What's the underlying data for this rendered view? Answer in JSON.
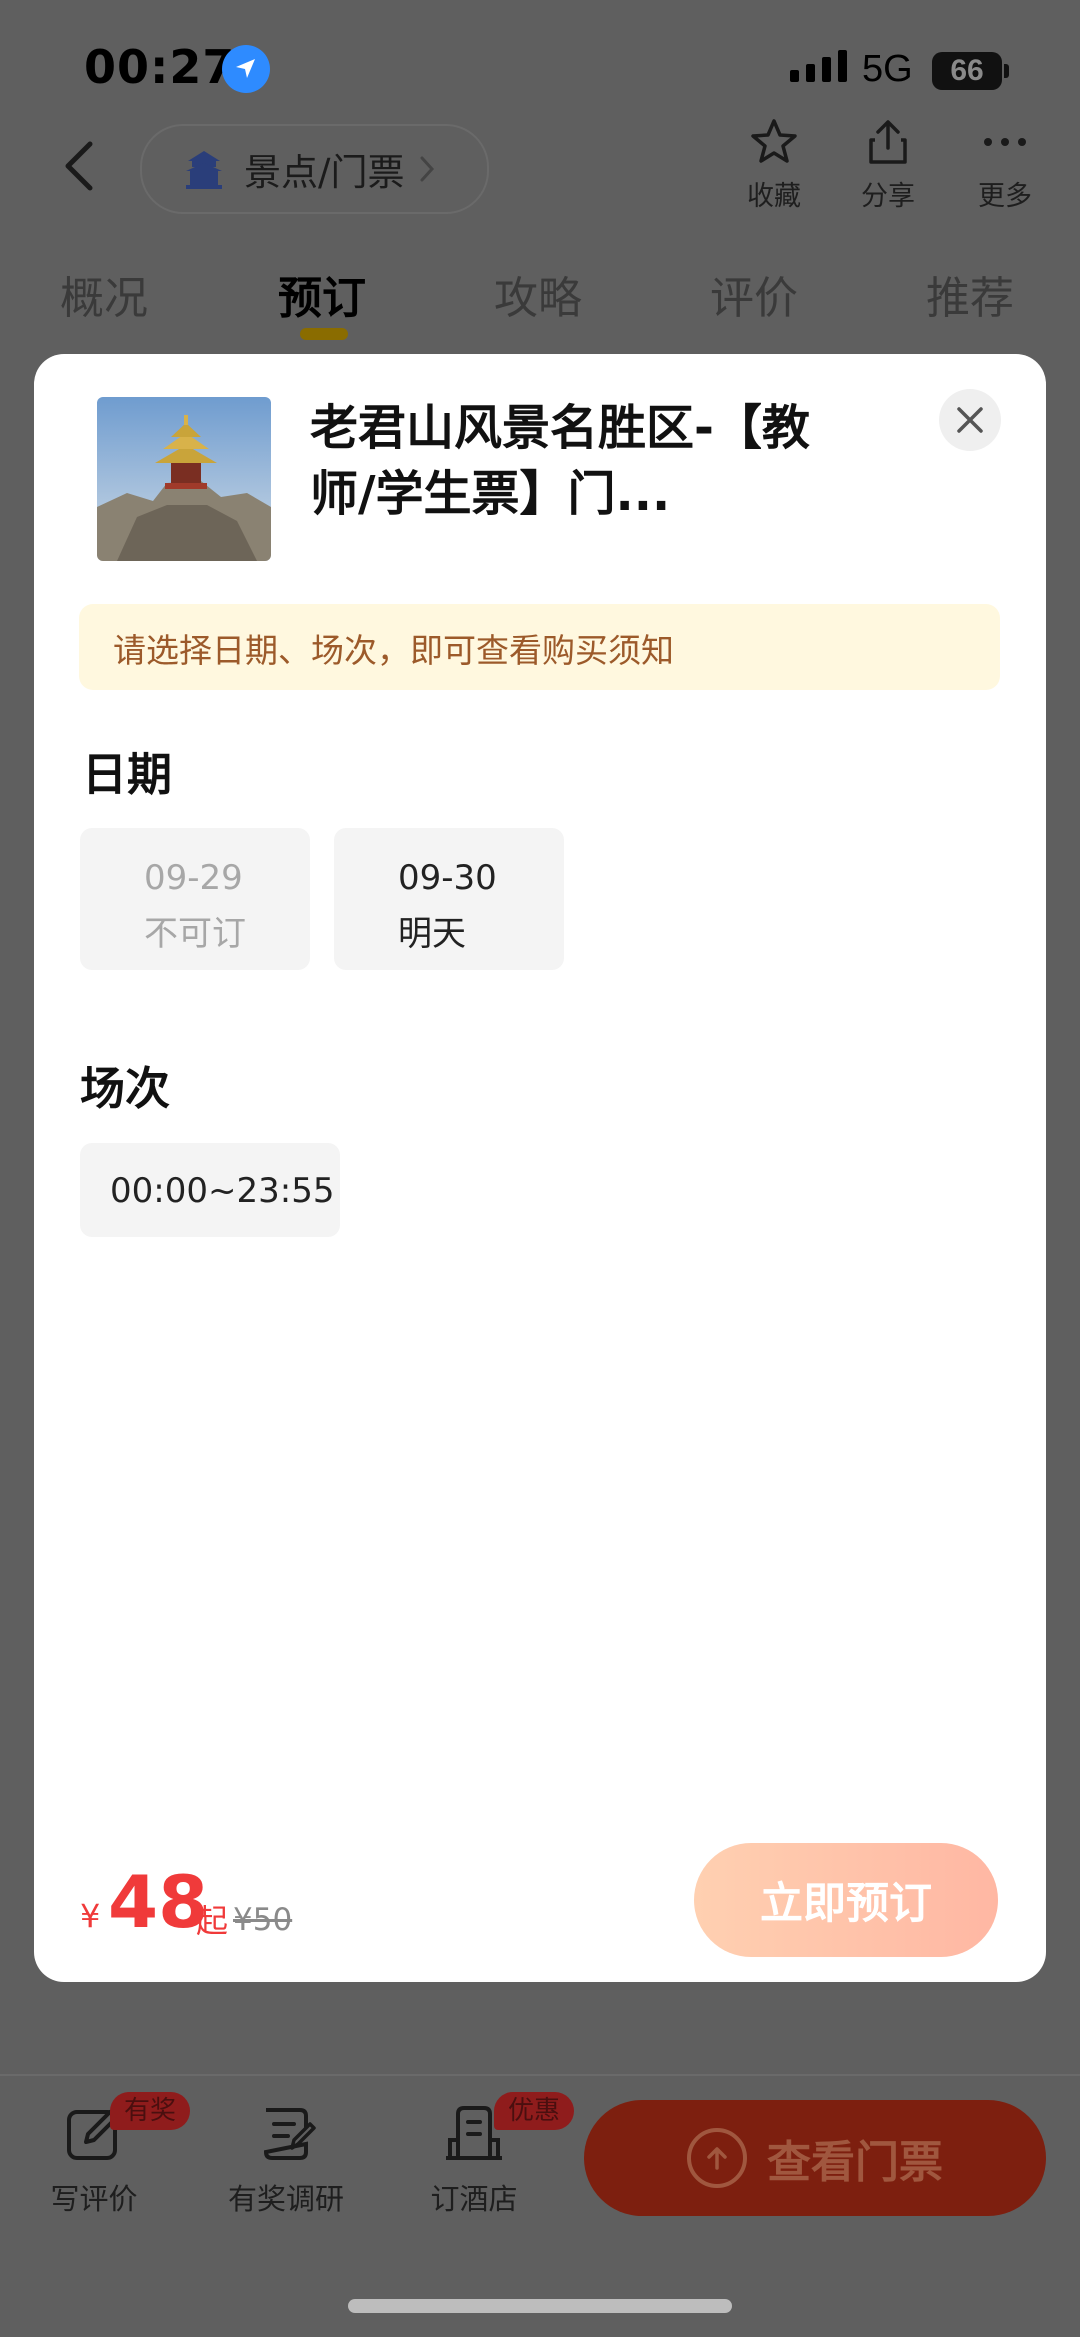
{
  "status": {
    "time": "00:27",
    "network": "5G",
    "battery": "66"
  },
  "header": {
    "breadcrumb": "景点/门票",
    "actions": [
      {
        "label": "收藏",
        "icon": "star-icon"
      },
      {
        "label": "分享",
        "icon": "share-icon"
      },
      {
        "label": "更多",
        "icon": "more-icon"
      }
    ]
  },
  "tabs": [
    "概况",
    "预订",
    "攻略",
    "评价",
    "推荐"
  ],
  "active_tab": "预订",
  "sheet": {
    "title": "老君山风景名胜区-【教师/学生票】门...",
    "notice": "请选择日期、场次，即可查看购买须知",
    "date_title": "日期",
    "dates": [
      {
        "date": "09-29",
        "label": "不可订",
        "available": false
      },
      {
        "date": "09-30",
        "label": "明天",
        "available": true
      }
    ],
    "session_title": "场次",
    "sessions": [
      "00:00~23:55"
    ],
    "price": {
      "symbol": "¥",
      "value": "48",
      "suffix": "起",
      "original": "¥50"
    },
    "book_label": "立即预订"
  },
  "bottom_bar": {
    "items": [
      {
        "label": "写评价",
        "icon": "edit-icon",
        "badge": "有奖"
      },
      {
        "label": "有奖调研",
        "icon": "survey-icon",
        "badge": ""
      },
      {
        "label": "订酒店",
        "icon": "hotel-icon",
        "badge": "优惠"
      }
    ],
    "cta_label": "查看门票"
  }
}
